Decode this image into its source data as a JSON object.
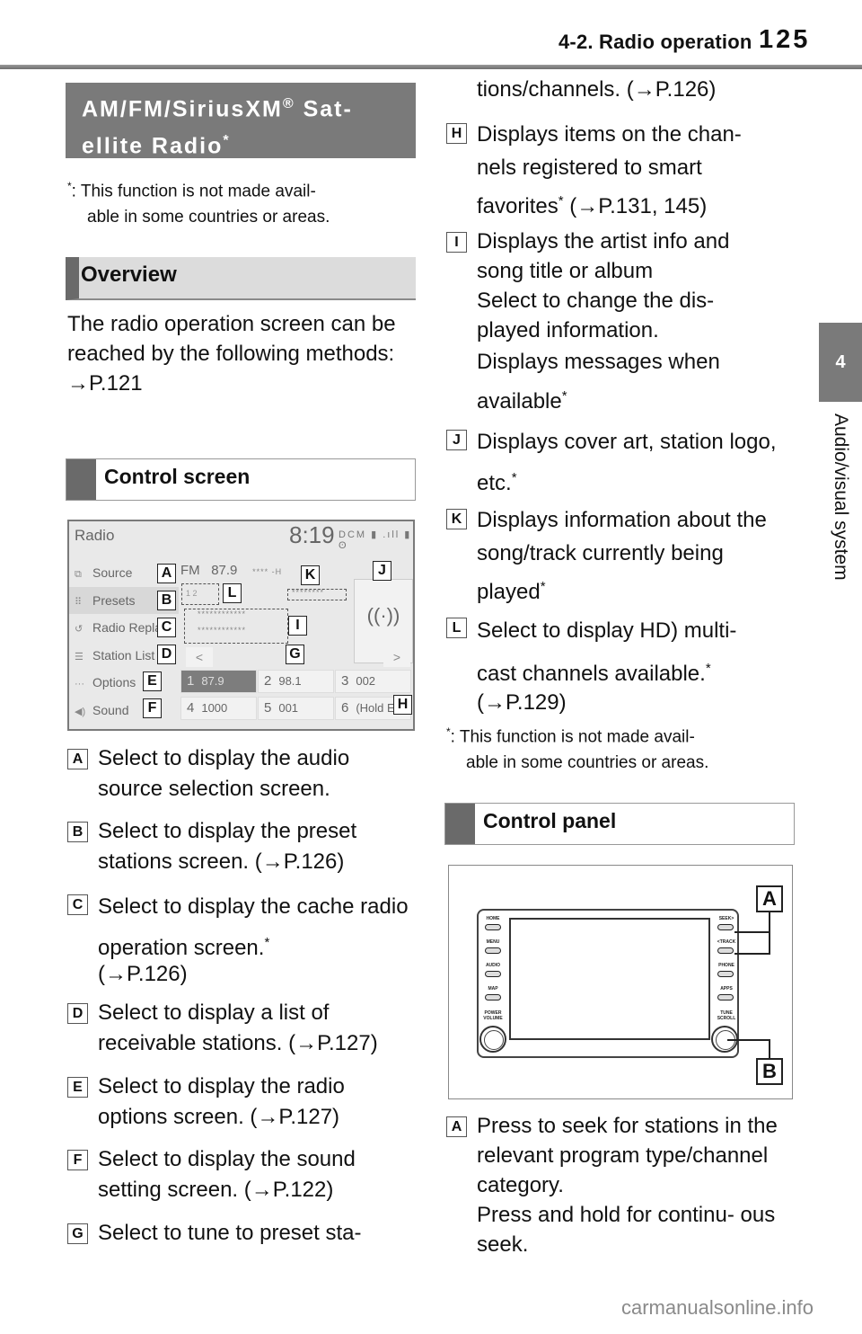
{
  "header": {
    "section": "4-2. Radio operation",
    "page_number": "125"
  },
  "side_tab": {
    "chapter_number": "4",
    "chapter_title": "Audio/visual system"
  },
  "title": {
    "line1": "AM/FM/SiriusXM",
    "registered": "®",
    "line1_suffix": " Sat-",
    "line2": "ellite Radio",
    "asterisk": "*"
  },
  "footnote": {
    "marker": "*",
    "line1": ": This function is not made avail-",
    "line2": "able in some countries or areas."
  },
  "overview": {
    "heading": "Overview",
    "text": "The radio operation screen can be reached by the following methods:",
    "ref": "→P.121"
  },
  "control_screen": {
    "heading": "Control screen",
    "screen": {
      "title": "Radio",
      "time": "8:19",
      "status_icons": "DCM ▮ .ıll ▮ ʘ",
      "menu": [
        {
          "icon": "source-icon",
          "glyph": "⧉",
          "label": "Source"
        },
        {
          "icon": "presets-icon",
          "glyph": "⠿",
          "label": "Presets"
        },
        {
          "icon": "radio-replay-icon",
          "glyph": "↺",
          "label": "Radio Replay"
        },
        {
          "icon": "station-list-icon",
          "glyph": "☰",
          "label": "Station List"
        },
        {
          "icon": "options-icon",
          "glyph": "···",
          "label": "Options"
        },
        {
          "icon": "sound-icon",
          "glyph": "◀)",
          "label": "Sound"
        }
      ],
      "band": "FM",
      "frequency": "87.9",
      "station_name": "**** -H",
      "hd_channels": "1 2",
      "song_info": "********",
      "artist": "************",
      "track": "************",
      "prev_label": "<",
      "next_label": ">",
      "presets": [
        {
          "num": "1",
          "value": "87.9",
          "active": true
        },
        {
          "num": "2",
          "value": "98.1"
        },
        {
          "num": "3",
          "value": "002"
        },
        {
          "num": "4",
          "value": "1000"
        },
        {
          "num": "5",
          "value": "001"
        },
        {
          "num": "6",
          "value": "(Hold E"
        }
      ],
      "callouts": [
        "A",
        "B",
        "C",
        "D",
        "E",
        "F",
        "G",
        "H",
        "I",
        "J",
        "K",
        "L"
      ]
    },
    "items": [
      {
        "mark": "A",
        "text": "Select to display the audio source selection screen."
      },
      {
        "mark": "B",
        "text": "Select to display the preset stations screen. (→P.126)"
      },
      {
        "mark": "C",
        "text": "Select to display the cache radio operation screen.",
        "asterisk": "*",
        "ref": "(→P.126)"
      },
      {
        "mark": "D",
        "text": "Select to display a list of receivable stations. (→P.127)"
      },
      {
        "mark": "E",
        "text": "Select to display the radio options screen. (→P.127)"
      },
      {
        "mark": "F",
        "text": "Select to display the sound setting screen. (→P.122)"
      },
      {
        "mark": "G",
        "text": "Select to tune to preset sta-",
        "continued": "tions/channels. (→P.126)"
      },
      {
        "mark": "H",
        "text": "Displays items on the chan- nels registered to smart favorites",
        "asterisk": "*",
        "ref": " (→P.131, 145)"
      },
      {
        "mark": "I",
        "text": "Displays the artist info and song title or album",
        "line2": "Select to change the dis- played information.",
        "line3": "Displays messages when available",
        "asterisk": "*"
      },
      {
        "mark": "J",
        "text": "Displays cover art, station logo, etc.",
        "asterisk": "*"
      },
      {
        "mark": "K",
        "text": "Displays information about the song/track currently being played",
        "asterisk": "*"
      },
      {
        "mark": "L",
        "text": "Select to display HD) multi- cast channels available.",
        "asterisk": "*",
        "ref": "(→P.129)"
      }
    ],
    "footnote": {
      "marker": "*",
      "line1": ": This function is not made avail-",
      "line2": "able in some countries or areas."
    }
  },
  "control_panel": {
    "heading": "Control panel",
    "left_buttons": [
      "HOME",
      "MENU",
      "AUDIO",
      "MAP"
    ],
    "left_knob": "POWER VOLUME",
    "right_buttons": [
      "SEEK>",
      "<TRACK",
      "PHONE",
      "APPS"
    ],
    "right_knob": "TUNE SCROLL",
    "callouts": [
      "A",
      "B"
    ],
    "items": [
      {
        "mark": "A",
        "text": "Press to seek for stations in the relevant program type/channel category.",
        "line2": "Press and hold for continu- ous seek."
      }
    ]
  },
  "watermark": "carmanualsonline.info"
}
